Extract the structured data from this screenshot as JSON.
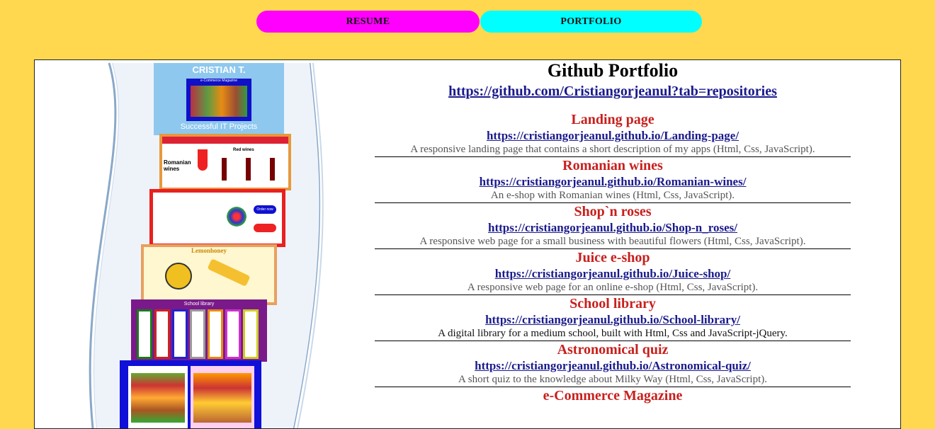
{
  "nav": {
    "resume_label": "RESUME",
    "portfolio_label": "PORTFOLIO"
  },
  "collage": {
    "banner_title": "CRISTIAN T.",
    "banner_subtitle": "e-Commerce Magazine",
    "banner_caption": "Successful IT Projects",
    "wines_label": "Romanian wines",
    "wines_red": "Red wines",
    "roses_order": "Order now",
    "lemon_title": "Lemonhoney",
    "library_title": "School library"
  },
  "portfolio": {
    "title": "Github Portfolio",
    "github_url": "https://github.com/Cristiangorjeanul?tab=repositories",
    "projects": [
      {
        "title": "Landing page",
        "url": "https://cristiangorjeanul.github.io/Landing-page/",
        "desc": "A responsive landing page that contains a short description of my apps (Html, Css, JavaScript)."
      },
      {
        "title": "Romanian wines",
        "url": "https://cristiangorjeanul.github.io/Romanian-wines/",
        "desc": "An e-shop with Romanian wines (Html, Css, JavaScript)."
      },
      {
        "title": "Shop`n roses",
        "url": "https://cristiangorjeanul.github.io/Shop-n_roses/",
        "desc": "A responsive web page for a small business with beautiful flowers (Html, Css, JavaScript)."
      },
      {
        "title": "Juice e-shop",
        "url": "https://cristiangorjeanul.github.io/Juice-shop/",
        "desc": "A responsive web page for an online e-shop (Html, Css, JavaScript)."
      },
      {
        "title": "School library",
        "url": "https://cristiangorjeanul.github.io/School-library/",
        "desc": "A digital library for a medium school, built with Html, Css and JavaScript-jQuery."
      },
      {
        "title": "Astronomical quiz",
        "url": "https://cristiangorjeanul.github.io/Astronomical-quiz/",
        "desc": "A short quiz to the knowledge about Milky Way (Html, Css, JavaScript)."
      },
      {
        "title": "e-Commerce Magazine"
      }
    ]
  },
  "colors": {
    "background": "#ffd84f",
    "resume_button": "#ff00ff",
    "portfolio_button": "#00ffff",
    "project_title": "#c8201d",
    "link": "#1a1a8c"
  }
}
